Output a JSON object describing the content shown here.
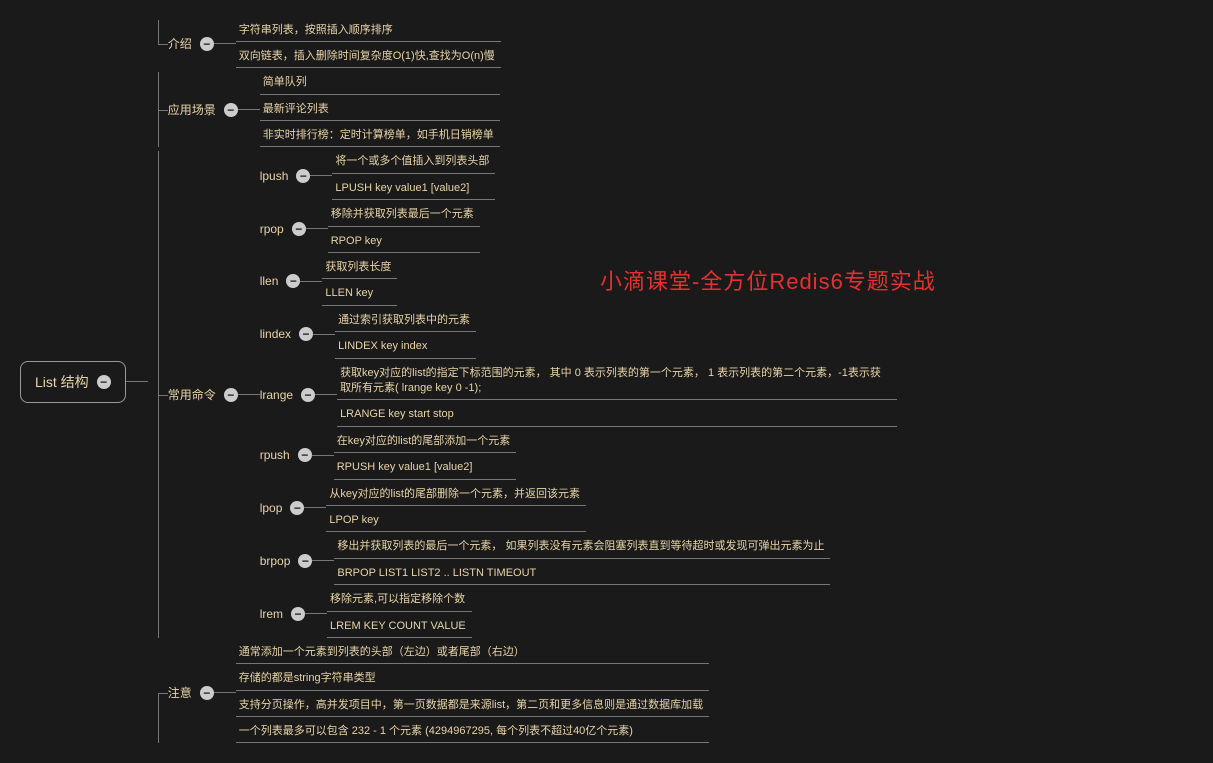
{
  "watermark": "小滴课堂-全方位Redis6专题实战",
  "root": {
    "label": "List 结构"
  },
  "branches": {
    "intro": {
      "label": "介绍",
      "items": [
        "字符串列表，按照插入顺序排序",
        "双向链表，插入删除时间复杂度O(1)快,查找为O(n)慢"
      ]
    },
    "scenes": {
      "label": "应用场景",
      "items": [
        "简单队列",
        "最新评论列表",
        "非实时排行榜：定时计算榜单，如手机日销榜单"
      ]
    },
    "cmds": {
      "label": "常用命令",
      "items": {
        "lpush": {
          "label": "lpush",
          "leaves": [
            "将一个或多个值插入到列表头部",
            "LPUSH key value1 [value2]"
          ]
        },
        "rpop": {
          "label": "rpop",
          "leaves": [
            "移除并获取列表最后一个元素",
            "RPOP key"
          ]
        },
        "llen": {
          "label": "llen",
          "leaves": [
            "获取列表长度",
            "LLEN key"
          ]
        },
        "lindex": {
          "label": "lindex",
          "leaves": [
            "通过索引获取列表中的元素",
            "LINDEX key index"
          ]
        },
        "lrange": {
          "label": "lrange",
          "leaves": [
            "获取key对应的list的指定下标范围的元素，  其中 0 表示列表的第一个元素，  1 表示列表的第二个元素，-1表示获取所有元素( lrange key 0 -1);",
            "LRANGE key start stop"
          ]
        },
        "rpush": {
          "label": "rpush",
          "leaves": [
            "在key对应的list的尾部添加一个元素",
            "RPUSH key value1 [value2]"
          ]
        },
        "lpop": {
          "label": "lpop",
          "leaves": [
            "从key对应的list的尾部删除一个元素，并返回该元素",
            "LPOP key"
          ]
        },
        "brpop": {
          "label": "brpop",
          "leaves": [
            "移出并获取列表的最后一个元素， 如果列表没有元素会阻塞列表直到等待超时或发现可弹出元素为止",
            "BRPOP LIST1 LIST2 .. LISTN TIMEOUT"
          ]
        },
        "lrem": {
          "label": "lrem",
          "leaves": [
            "移除元素,可以指定移除个数",
            "LREM KEY COUNT VALUE"
          ]
        }
      }
    },
    "notes": {
      "label": "注意",
      "items": [
        "通常添加一个元素到列表的头部（左边）或者尾部（右边）",
        "存储的都是string字符串类型",
        "支持分页操作，高并发项目中，第一页数据都是来源list，第二页和更多信息则是通过数据库加载",
        "一个列表最多可以包含 232 - 1 个元素 (4294967295, 每个列表不超过40亿个元素)"
      ]
    }
  }
}
